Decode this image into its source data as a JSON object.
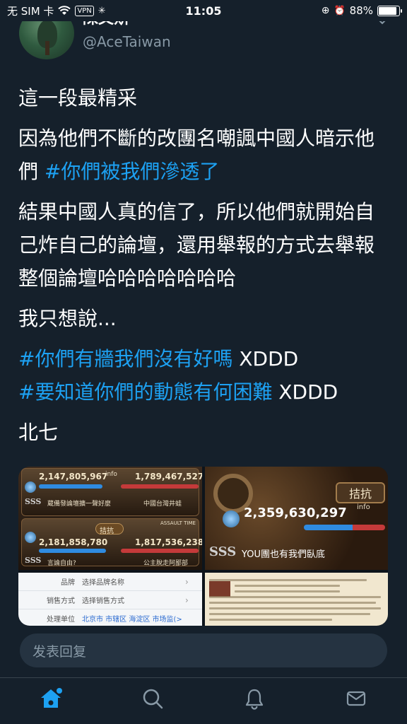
{
  "status_bar": {
    "carrier": "无 SIM 卡",
    "vpn": "VPN",
    "time": "11:05",
    "battery": "88%",
    "battery_level": 0.88
  },
  "tweet": {
    "display_name": "陳文斯",
    "handle": "@AceTaiwan",
    "paragraphs": {
      "p1": "這一段最精采",
      "p2_text": "因為他們不斷的改團名嘲諷中國人暗示他們",
      "p2_hashtag": "#你們被我們滲透了",
      "p3": "結果中國人真的信了，所以他們就開始自己炸自己的論壇，還用舉報的方式去舉報整個論壇哈哈哈哈哈哈哈",
      "p4": "我只想說...",
      "p5_hashtag": "#你們有牆我們沒有好嗎",
      "p5_suffix": " XDDD",
      "p6_hashtag": "#要知道你們的動態有何困難",
      "p6_suffix": " XDDD",
      "p7": "北七"
    }
  },
  "media": {
    "tile_a": {
      "row1_left": "2,147,805,967",
      "row1_right": "1,789,467,527",
      "row1_left_name": "蔵備發論壇擴一聲好麼",
      "row1_right_name": "中國台灣井蛙",
      "row1_info": "info",
      "row2_left": "2,181,858,780",
      "row2_right": "1,817,536,238",
      "row2_title": "拮抗",
      "row2_tag": "ASSAULT TIME",
      "row2_left_name": "言論自由?",
      "row2_right_name": "公主脫走阿鄙部",
      "sss": "SSS"
    },
    "tile_b": {
      "title": "拮抗",
      "info": "info",
      "score": "2,359,630,297",
      "sss": "SSS",
      "caption": "YOU團也有我們臥底"
    },
    "tile_c": {
      "rows": [
        {
          "label": "品牌",
          "value": "选择品牌名称"
        },
        {
          "label": "销售方式",
          "value": "选择销售方式"
        },
        {
          "label": "处理单位",
          "value": "北京市 市辖区 海淀区 市场监(>"
        }
      ]
    }
  },
  "reply": {
    "placeholder": "发表回复"
  },
  "nav": {
    "items": [
      "home",
      "search",
      "notifications",
      "messages"
    ]
  },
  "colors": {
    "background": "#15202b",
    "accent": "#1da1f2",
    "muted": "#8899a6",
    "input_bg": "#253341"
  }
}
